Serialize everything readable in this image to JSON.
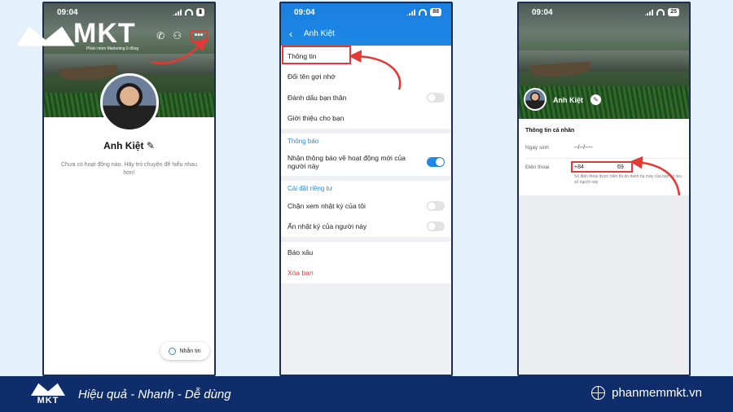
{
  "colors": {
    "accent": "#1e88e5",
    "highlight": "#e53935",
    "footer_bg": "#0f2d6b",
    "page_bg": "#e4f1fb"
  },
  "logo": {
    "text": "MKT",
    "subtitle": "Phần mềm Marketing 0 đồng"
  },
  "screen1": {
    "time": "09:04",
    "profile_name": "Anh Kiệt",
    "activity_text": "Chưa có hoạt động nào. Hãy trò chuyện để hiểu nhau hơn!",
    "message_button": "Nhắn tin",
    "icons": [
      "call-icon",
      "add-friend-icon",
      "more-icon"
    ]
  },
  "screen2": {
    "time": "09:04",
    "battery": "88",
    "header_title": "Anh Kiệt",
    "items": {
      "info": "Thông tin",
      "nickname": "Đổi tên gợi nhớ",
      "close_friend": "Đánh dấu bạn thân",
      "introduce": "Giới thiệu cho bạn",
      "notify_section": "Thông báo",
      "notify_activity": "Nhận thông báo về hoạt động mới của người này",
      "privacy_section": "Cài đặt riêng tư",
      "block_diary": "Chặn xem nhật ký của tôi",
      "hide_diary": "Ẩn nhật ký của người này",
      "report": "Báo xấu",
      "delete_friend": "Xóa bạn"
    },
    "toggles": {
      "close_friend": false,
      "notify_activity": true,
      "block_diary": false,
      "hide_diary": false
    }
  },
  "screen3": {
    "time": "09:04",
    "battery": "25",
    "profile_name": "Anh Kiệt",
    "section_title": "Thông tin cá nhân",
    "birthday_label": "Ngày sinh",
    "birthday_value": "--/--/----",
    "phone_label": "Điện thoại",
    "phone_prefix": "+84",
    "phone_suffix": "69",
    "phone_hint": "Số điện thoại được hiển thị do danh bạ máy của bạn có lưu số người này"
  },
  "footer": {
    "logo_text": "MKT",
    "slogan": "Hiệu quả - Nhanh - Dễ dùng",
    "website": "phanmemmkt.vn"
  }
}
